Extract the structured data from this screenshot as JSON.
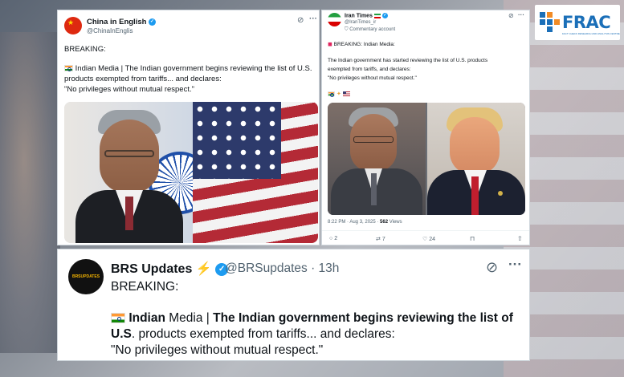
{
  "colors": {
    "accent": "#1d9bf0",
    "text": "#0f1419",
    "muted": "#536471",
    "frac_blue": "#1b6fb8",
    "lightning": "#f4b400"
  },
  "watermark": {
    "logo_text": "FRAC",
    "tagline": "FACT CHECK RESEARCH AND ANALYSIS CENTRE"
  },
  "tweet_china": {
    "name": "China in English",
    "handle": "@ChinaInEnglis",
    "line1": "BREAKING:",
    "line2": "Indian Media | The Indian government begins reviewing the list of U.S.",
    "line3": "products exempted from tariffs... and declares:",
    "line4": "\"No privileges without mutual respect.\"",
    "icons": [
      "grok-icon",
      "more-icon",
      "india-flag-icon",
      "china-flag-icon",
      "verified-icon"
    ]
  },
  "tweet_iran": {
    "name": "Iran Times",
    "handle": "@IranTimes_ir",
    "account_label": "Commentary account",
    "breaking": "BREAKING: Indian Media:",
    "line1": "The Indian government has started reviewing the list of U.S. products",
    "line2": "exempted from tariffs, and declares:",
    "line3": "\"No privileges without mutual respect.\"",
    "timestamp": "8:22 PM · Aug 3, 2025 · ",
    "views_count": "562",
    "views_label": " Views",
    "replies": "2",
    "reposts": "7",
    "likes": "24",
    "icons": [
      "iran-flag-icon",
      "handshake-icon",
      "us-flag-icon",
      "siren-icon"
    ]
  },
  "tweet_brs": {
    "name": "BRS Updates",
    "avatar_text": "BRSUPDATES",
    "handle": "@BRSupdates",
    "separator": " · ",
    "time": "13h",
    "line1": "BREAKING:",
    "line2_bold_a": "Indian",
    "line2_plain_a": " Media | ",
    "line2_bold_b": "The Indian government begins reviewing the list of",
    "line3_bold": "U.S",
    "line3_plain": ". products exempted from tariffs... and declares:",
    "line4": "\"No privileges without mutual respect.\""
  }
}
